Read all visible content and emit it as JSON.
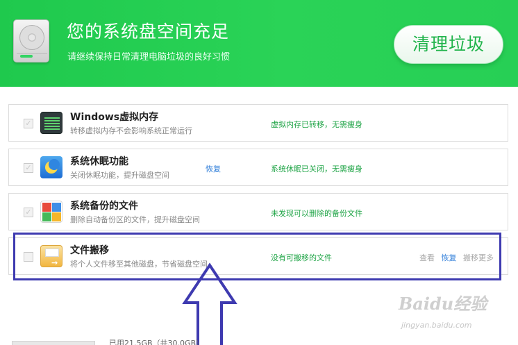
{
  "header": {
    "title": "您的系统盘空间充足",
    "subtitle": "请继续保持日常清理电脑垃圾的良好习惯",
    "clean_button": "清理垃圾"
  },
  "rows": [
    {
      "title": "Windows虚拟内存",
      "desc": "转移虚拟内存不会影响系统正常运行",
      "status": "虚拟内存已转移，无需瘦身",
      "checked": true,
      "icon": "memory-icon"
    },
    {
      "title": "系统休眠功能",
      "desc": "关闭休眠功能，提升磁盘空间",
      "restore": "恢复",
      "status": "系统休眠已关闭，无需瘦身",
      "checked": true,
      "icon": "hibernate-icon"
    },
    {
      "title": "系统备份的文件",
      "desc": "删除自动备份区的文件，提升磁盘空间",
      "status": "未发现可以删除的备份文件",
      "checked": true,
      "icon": "backup-icon"
    },
    {
      "title": "文件搬移",
      "desc": "将个人文件移至其他磁盘，节省磁盘空间",
      "status": "没有可搬移的文件",
      "actions": {
        "view": "查看",
        "restore": "恢复",
        "more": "搬移更多"
      },
      "checked": false,
      "icon": "migrate-icon"
    }
  ],
  "footer": {
    "usage_text": "已用21.5GB（共30.0GB）"
  },
  "watermark": {
    "logo": "Baidu经验",
    "url": "jingyan.baidu.com"
  },
  "colors": {
    "header_green": "#27cf55",
    "status_green": "#1fa446",
    "link_blue": "#2b7bd8",
    "annotation_blue": "#3e3ab0"
  }
}
